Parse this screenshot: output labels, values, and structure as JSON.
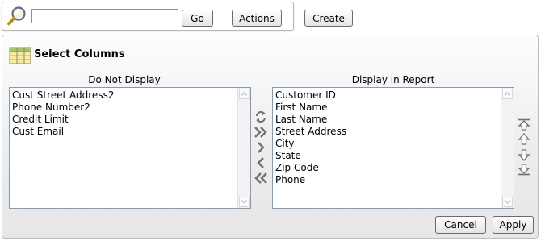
{
  "toolbar": {
    "search_value": "",
    "go_label": "Go",
    "actions_label": "Actions",
    "create_label": "Create"
  },
  "panel": {
    "title": "Select Columns",
    "left_label": "Do Not Display",
    "right_label": "Display in Report",
    "do_not_display": [
      "Cust Street Address2",
      "Phone Number2",
      "Credit Limit",
      "Cust Email"
    ],
    "display_in_report": [
      "Customer ID",
      "First Name",
      "Last Name",
      "Street Address",
      "City",
      "State",
      "Zip Code",
      "Phone"
    ],
    "move_icons": [
      "reset-icon",
      "move-all-right-icon",
      "move-right-icon",
      "move-left-icon",
      "move-all-left-icon"
    ],
    "order_icons": [
      "move-top-icon",
      "move-up-icon",
      "move-down-icon",
      "move-bottom-icon"
    ],
    "cancel_label": "Cancel",
    "apply_label": "Apply"
  },
  "colors": {
    "panel_border": "#bdbdbd",
    "list_border": "#7f9db9",
    "icon_gray": "#707070"
  }
}
